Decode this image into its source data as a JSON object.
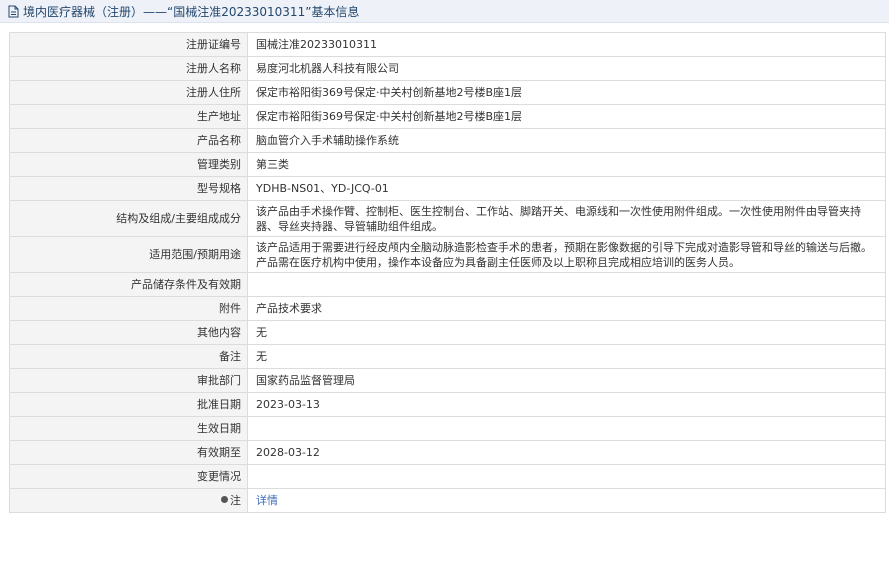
{
  "header": {
    "title": "境内医疗器械（注册）——“国械注准20233010311”基本信息",
    "icon": "document-icon",
    "color": "#24476d"
  },
  "rows": [
    {
      "label": "注册证编号",
      "value": "国械注准20233010311"
    },
    {
      "label": "注册人名称",
      "value": "易度河北机器人科技有限公司"
    },
    {
      "label": "注册人住所",
      "value": "保定市裕阳街369号保定·中关村创新基地2号楼B座1层"
    },
    {
      "label": "生产地址",
      "value": "保定市裕阳街369号保定·中关村创新基地2号楼B座1层"
    },
    {
      "label": "产品名称",
      "value": "脑血管介入手术辅助操作系统"
    },
    {
      "label": "管理类别",
      "value": "第三类"
    },
    {
      "label": "型号规格",
      "value": "YDHB-NS01、YD-JCQ-01"
    },
    {
      "label": "结构及组成/主要组成成分",
      "value": "该产品由手术操作臂、控制柜、医生控制台、工作站、脚踏开关、电源线和一次性使用附件组成。一次性使用附件由导管夹持器、导丝夹持器、导管辅助组件组成。"
    },
    {
      "label": "适用范围/预期用途",
      "value": "该产品适用于需要进行经皮颅内全脑动脉造影检查手术的患者，预期在影像数据的引导下完成对造影导管和导丝的输送与后撤。产品需在医疗机构中使用，操作本设备应为具备副主任医师及以上职称且完成相应培训的医务人员。"
    },
    {
      "label": "产品储存条件及有效期",
      "value": ""
    },
    {
      "label": "附件",
      "value": "产品技术要求"
    },
    {
      "label": "其他内容",
      "value": "无"
    },
    {
      "label": "备注",
      "value": "无"
    },
    {
      "label": "审批部门",
      "value": "国家药品监督管理局"
    },
    {
      "label": "批准日期",
      "value": "2023-03-13"
    },
    {
      "label": "生效日期",
      "value": ""
    },
    {
      "label": "有效期至",
      "value": "2028-03-12"
    },
    {
      "label": "变更情况",
      "value": ""
    }
  ],
  "note": {
    "label": "注",
    "link": "详情",
    "icon": "note-icon",
    "link_color": "#3c6db7"
  }
}
